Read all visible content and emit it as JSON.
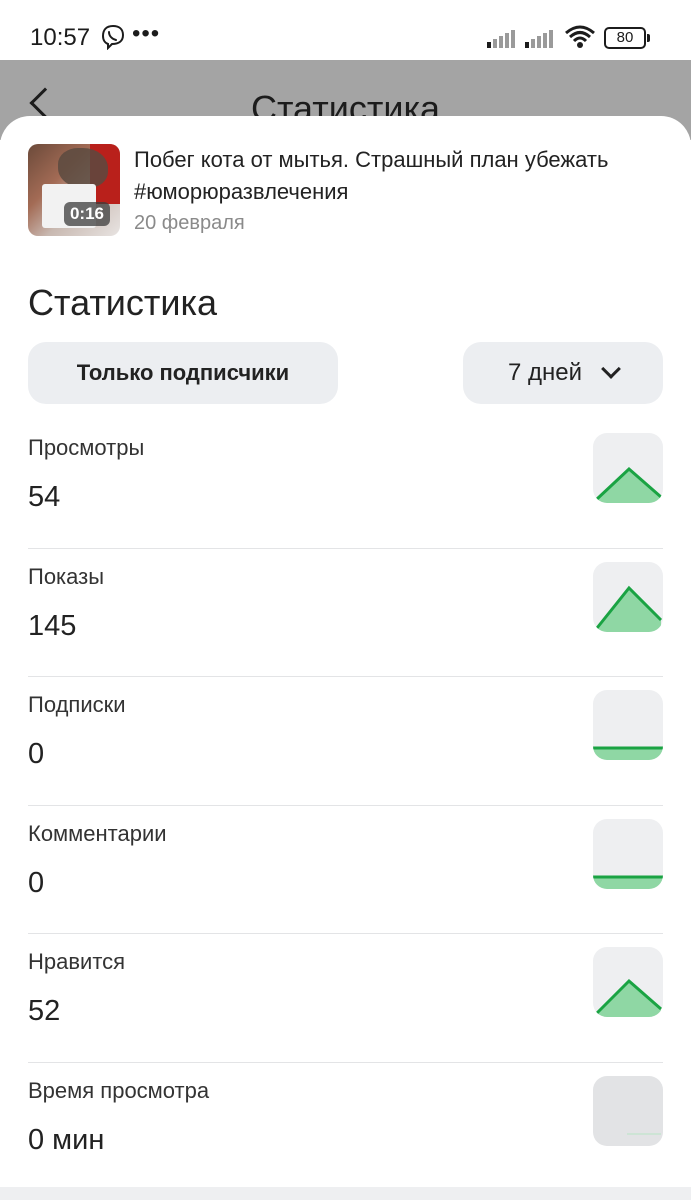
{
  "status_bar": {
    "time": "10:57",
    "dots": "•••",
    "battery": "80"
  },
  "background_page": {
    "title": "Статистика"
  },
  "video": {
    "title": "Побег кота от мытья. Страшный план убежать #юморюразвлечения",
    "date": "20 февраля",
    "duration": "0:16"
  },
  "stats": {
    "heading": "Статистика",
    "filter_label": "Только подписчики",
    "period_label": "7 дней",
    "rows": [
      {
        "label": "Просмотры",
        "value": "54",
        "trend": "up"
      },
      {
        "label": "Показы",
        "value": "145",
        "trend": "up"
      },
      {
        "label": "Подписки",
        "value": "0",
        "trend": "flat"
      },
      {
        "label": "Комментарии",
        "value": "0",
        "trend": "flat"
      },
      {
        "label": "Нравится",
        "value": "52",
        "trend": "up"
      },
      {
        "label": "Время просмотра",
        "value": "0 мин",
        "trend": "none"
      }
    ]
  },
  "colors": {
    "accent_green": "#1aa343",
    "fill_green": "#8fd7a4",
    "chip_bg": "#eceef1"
  }
}
